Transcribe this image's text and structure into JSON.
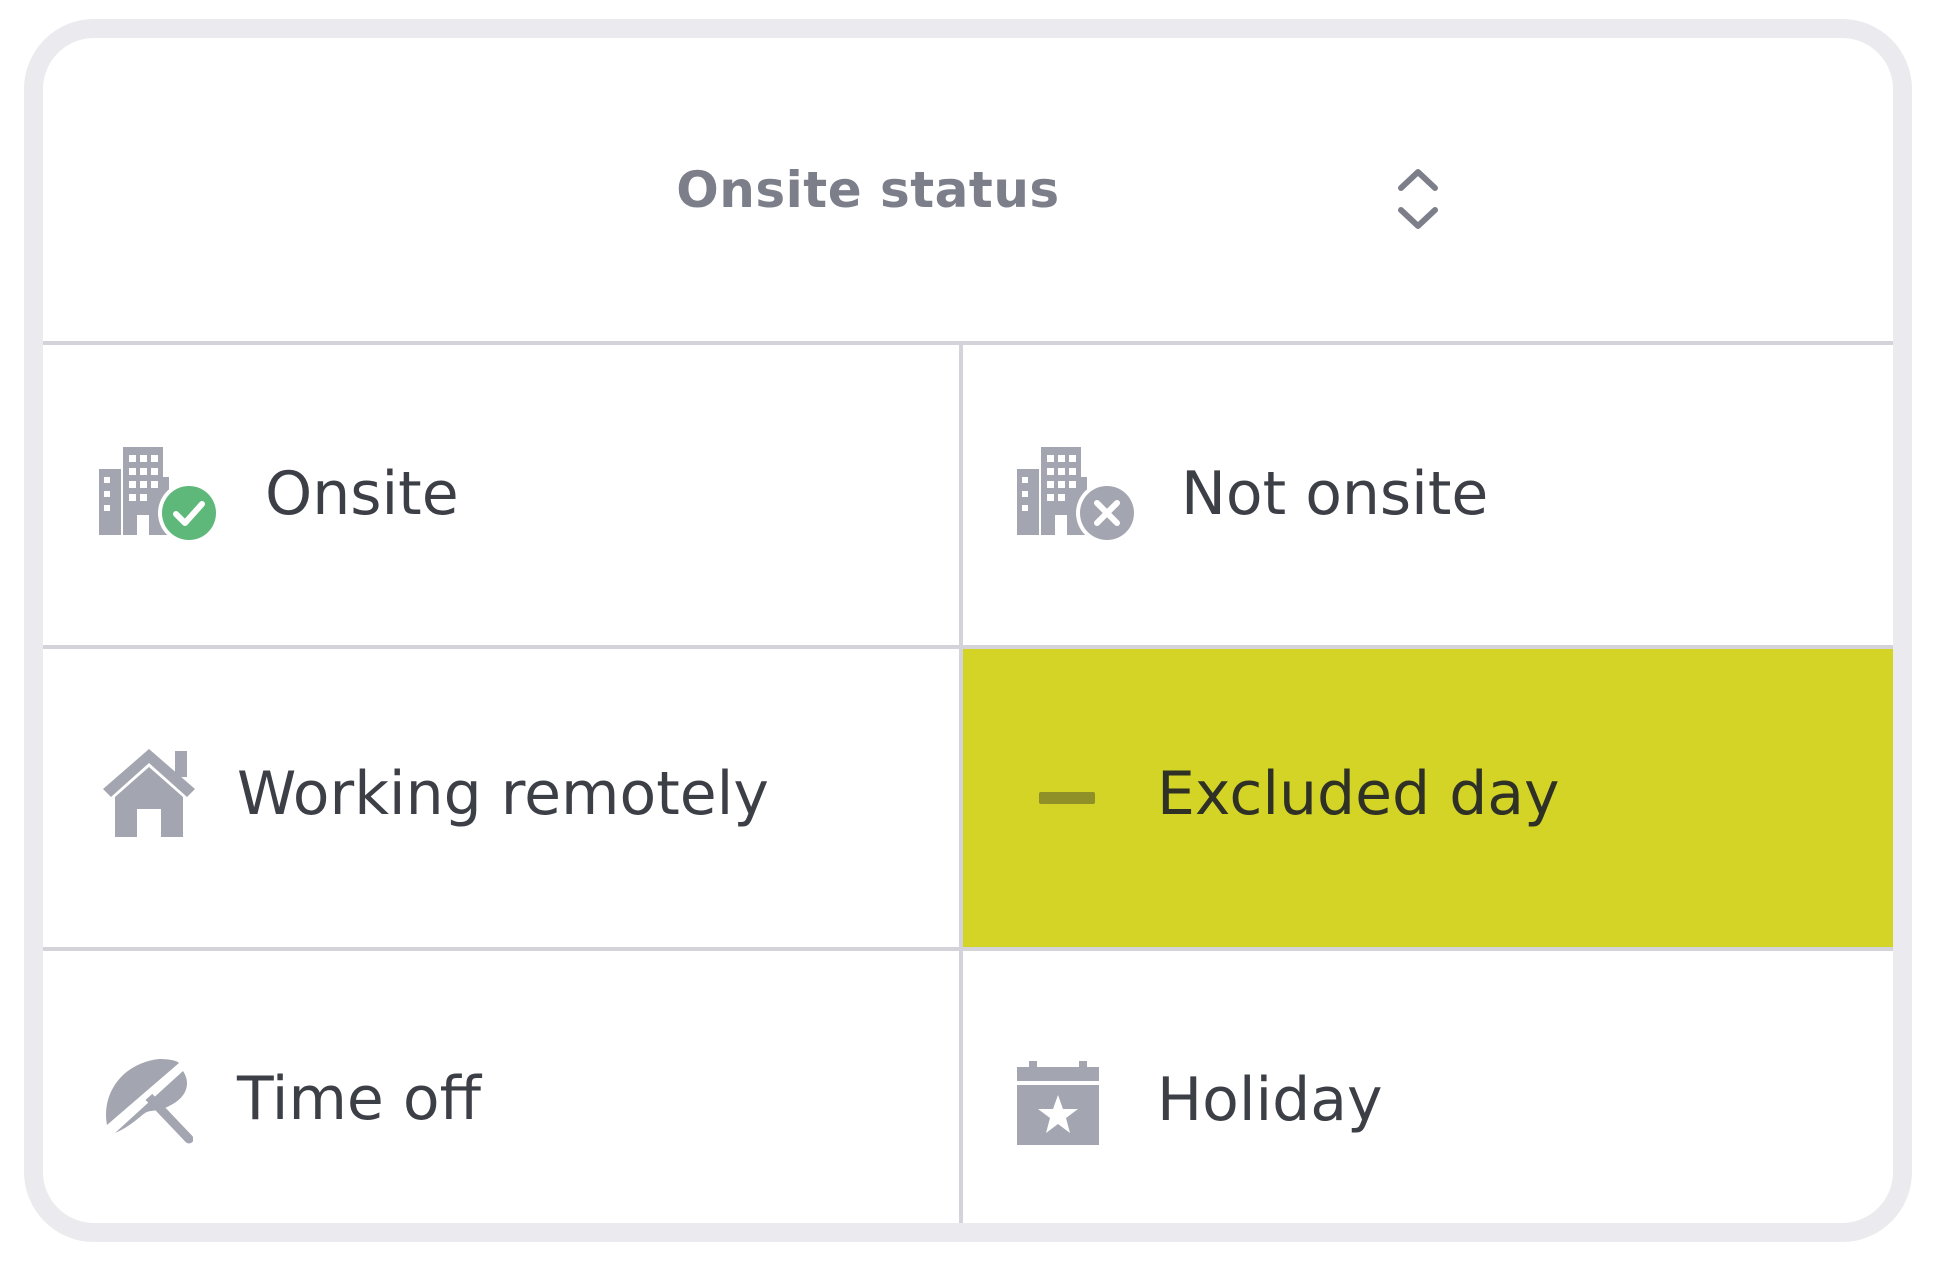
{
  "header": {
    "title": "Onsite status",
    "sort_icon": "chevron-up-down-icon"
  },
  "options": [
    {
      "label": "Onsite",
      "icon": "building-check-icon",
      "badge_color": "#5db87a"
    },
    {
      "label": "Not onsite",
      "icon": "building-x-icon",
      "badge_color": "#a3a6b0"
    },
    {
      "label": "Working remotely",
      "icon": "home-icon"
    },
    {
      "label": "Excluded day",
      "icon": "minus-icon",
      "selected": true,
      "highlight_color": "#d3d425"
    },
    {
      "label": "Time off",
      "icon": "umbrella-icon"
    },
    {
      "label": "Holiday",
      "icon": "calendar-star-icon"
    }
  ],
  "colors": {
    "icon_gray": "#a3a6b0",
    "border": "#d3d3d9",
    "card_outline": "#ebebef"
  }
}
